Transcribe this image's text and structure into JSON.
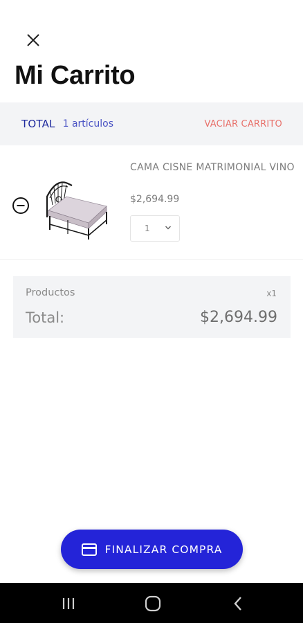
{
  "header": {
    "title": "Mi Carrito",
    "close_icon": "close-icon"
  },
  "summary": {
    "total_label": "TOTAL",
    "item_count": "1 artículos",
    "clear_label": "VACIAR CARRITO",
    "accent_color": "#1f2a9e",
    "clear_color": "#e8706a"
  },
  "cart": {
    "items": [
      {
        "name": "CAMA CISNE MATRIMONIAL VINO",
        "price": "$2,694.99",
        "quantity": "1",
        "image_icon": "bed-image"
      }
    ]
  },
  "totals": {
    "products_label": "Productos",
    "products_qty": "x1",
    "total_label": "Total:",
    "total_value": "$2,694.99"
  },
  "checkout": {
    "label": "FINALIZAR COMPRA",
    "icon": "credit-card-icon",
    "color": "#2424d8"
  },
  "navigation": {
    "recents_icon": "recents-icon",
    "home_icon": "home-icon",
    "back_icon": "back-icon"
  }
}
